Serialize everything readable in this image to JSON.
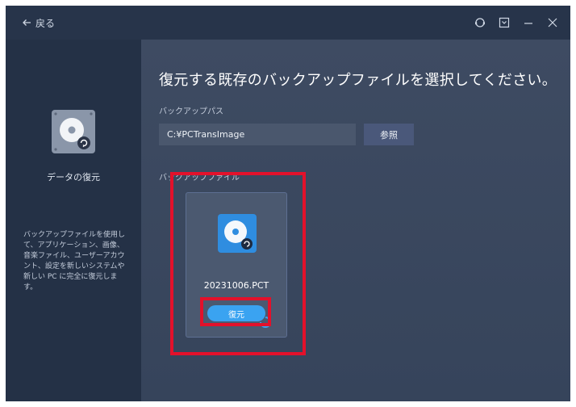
{
  "titlebar": {
    "back_label": "戻る",
    "controls": [
      "help-icon",
      "menu-icon",
      "minimize-icon",
      "close-icon"
    ]
  },
  "sidebar": {
    "icon": "backup-drive-icon",
    "title": "データの復元",
    "description": "バックアップファイルを使用して、アプリケーション、画像、音楽ファイル、ユーザーアカウント、設定を新しいシステムや新しい PC に完全に復元します。"
  },
  "main": {
    "heading": "復元する既存のバックアップファイルを選択してください。",
    "backup_path_label": "バックアップパス",
    "backup_path_value": "C:¥PCTransImage",
    "browse_label": "参照",
    "backup_files_label": "バックアップファイル",
    "files": [
      {
        "name": "20231006.PCT",
        "restore_label": "復元"
      }
    ]
  },
  "colors": {
    "accent": "#3aa3f1",
    "highlight": "#e3112b",
    "sidebar_bg": "#243146",
    "main_bg": "#3e4b62"
  }
}
